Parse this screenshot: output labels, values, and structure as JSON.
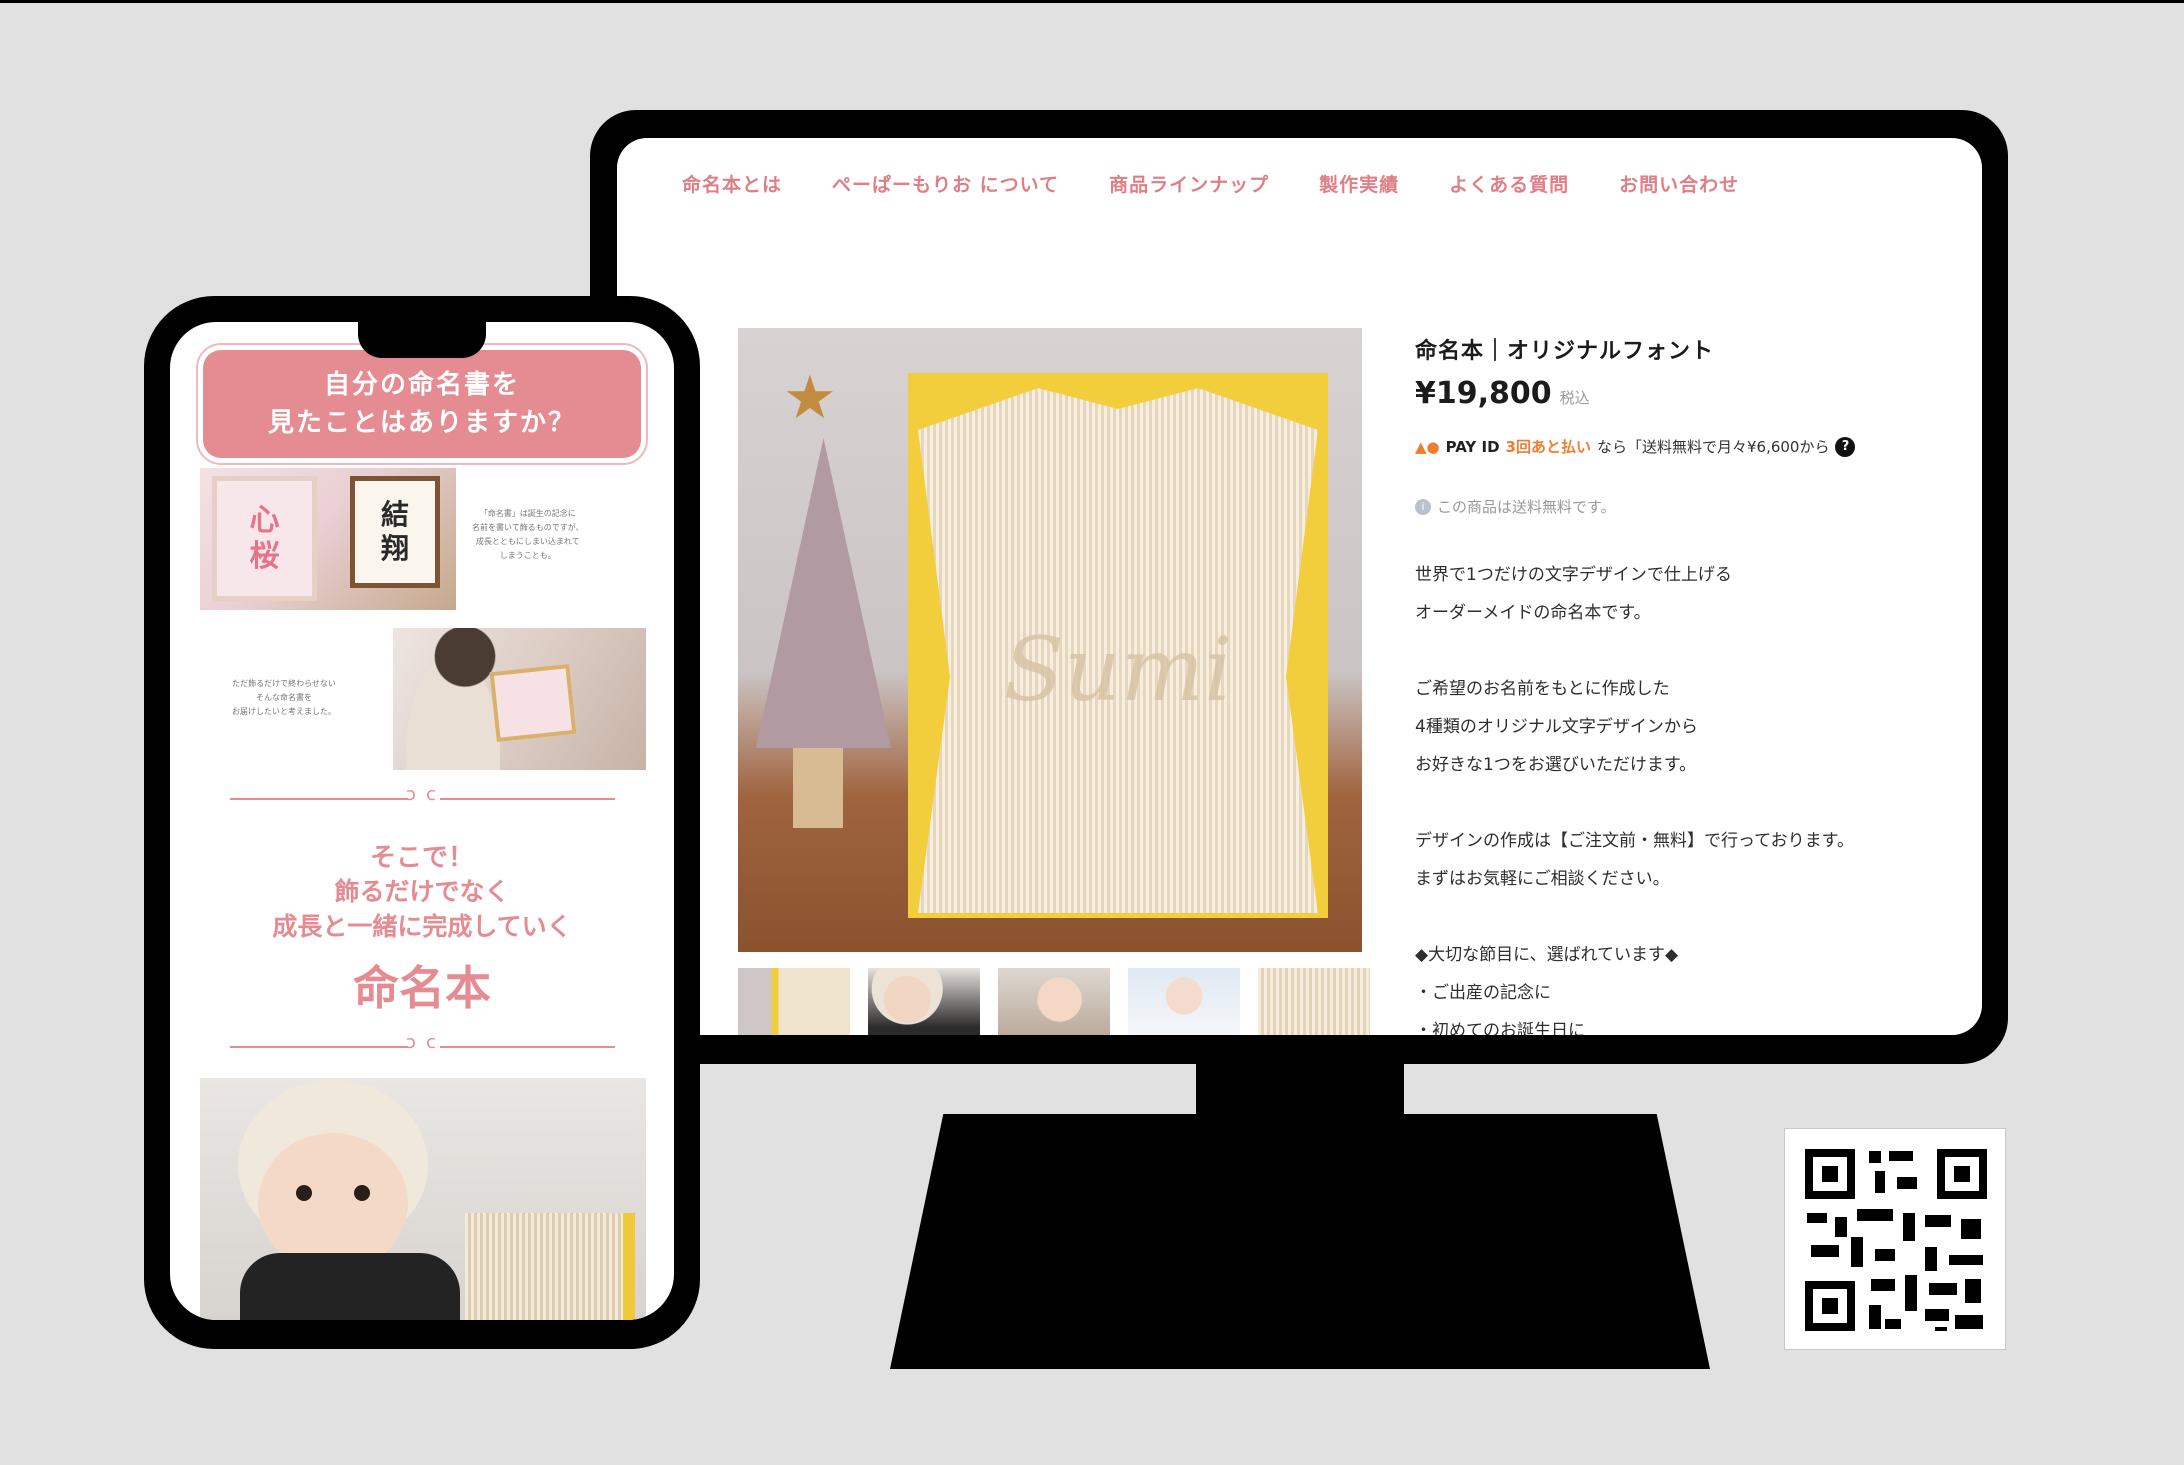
{
  "nav": {
    "items": [
      "命名本とは",
      "ぺーぱーもりお について",
      "商品ラインナップ",
      "製作実績",
      "よくある質問",
      "お問い合わせ"
    ]
  },
  "product": {
    "title": "命名本｜オリジナルフォント",
    "price": "¥19,800",
    "tax_label": "税込",
    "pay": {
      "dots": "▲●",
      "brand": "PAY ID",
      "highlight": "3回あと払い",
      "text": "なら「送料無料で月々¥6,600から",
      "help_icon": "?"
    },
    "shipping": {
      "icon": "i",
      "text": "この商品は送料無料です。"
    },
    "description": [
      "世界で1つだけの文字デザインで仕上げる",
      "オーダーメイドの命名本です。",
      "",
      "ご希望のお名前をもとに作成した",
      "4種類のオリジナル文字デザインから",
      "お好きな1つをお選びいただけます。",
      "",
      "デザインの作成は【ご注文前・無料】で行っております。",
      "まずはお気軽にご相談ください。",
      "",
      "◆大切な節目に、選ばれています◆",
      "・ご出産の記念に",
      "・初めてのお誕生日に"
    ],
    "main_photo_word": "Sumi"
  },
  "phone": {
    "banner_lines": [
      "自分の命名書を",
      "見たことはありますか？"
    ],
    "frame_a_chars": [
      "心",
      "桜"
    ],
    "frame_b_chars": [
      "結",
      "翔"
    ],
    "note1": [
      "「命名書」は誕生の記念に",
      "名前を書いて飾るものですが、",
      "成長とともにしまい込まれて",
      "しまうことも。"
    ],
    "note2": [
      "ただ飾るだけで終わらせない",
      "そんな命名書を",
      "お届けしたいと考えました。"
    ],
    "soko_lines": [
      "そこで！",
      "飾るだけでなく",
      "成長と一緒に完成していく"
    ],
    "soko_title": "命名本"
  },
  "colors": {
    "accent_pink": "#e07e86",
    "banner_pink": "#e58b92",
    "pay_orange": "#ef7d2e",
    "background": "#e1e1e1",
    "device_black": "#000000"
  },
  "icons": [
    "help-icon",
    "info-icon",
    "star-icon",
    "qr-code"
  ]
}
